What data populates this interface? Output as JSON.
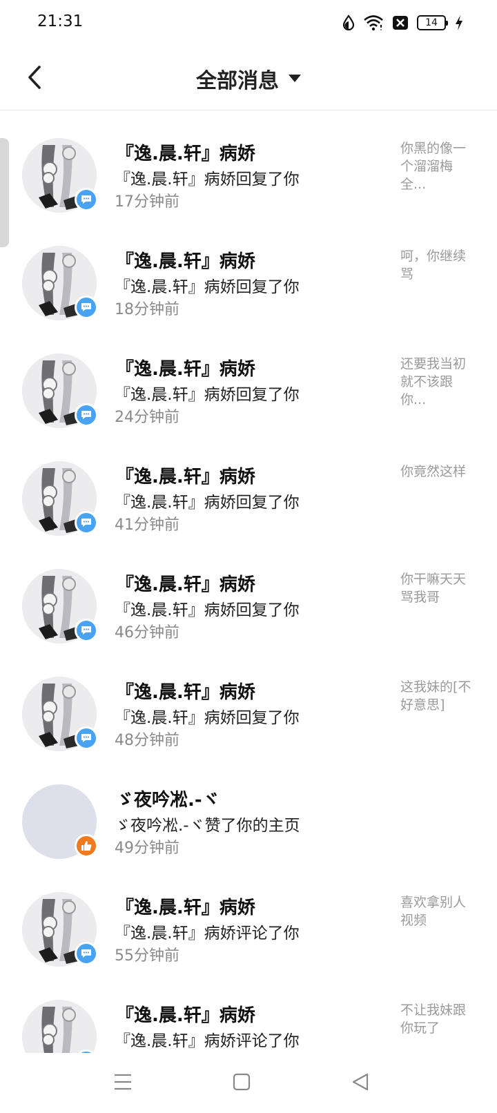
{
  "status_bar": {
    "time": "21:31",
    "battery_level": "14",
    "icons": [
      "data-saver-icon",
      "wifi-icon",
      "sim-blocked-icon",
      "battery-icon",
      "charging-icon"
    ]
  },
  "header": {
    "title": "全部消息",
    "back_icon": "chevron-left-icon",
    "dropdown_icon": "caret-down-icon"
  },
  "messages": [
    {
      "name": "『逸.晨.轩』病娇",
      "action": "『逸.晨.轩』病娇回复了你",
      "time": "17分钟前",
      "preview": "你黑的像一个溜溜梅全...",
      "badge": "comment"
    },
    {
      "name": "『逸.晨.轩』病娇",
      "action": "『逸.晨.轩』病娇回复了你",
      "time": "18分钟前",
      "preview": "呵，你继续骂",
      "badge": "comment"
    },
    {
      "name": "『逸.晨.轩』病娇",
      "action": "『逸.晨.轩』病娇回复了你",
      "time": "24分钟前",
      "preview": "还要我当初就不该跟你...",
      "badge": "comment"
    },
    {
      "name": "『逸.晨.轩』病娇",
      "action": "『逸.晨.轩』病娇回复了你",
      "time": "41分钟前",
      "preview": "你竟然这样",
      "badge": "comment"
    },
    {
      "name": "『逸.晨.轩』病娇",
      "action": "『逸.晨.轩』病娇回复了你",
      "time": "46分钟前",
      "preview": "你干嘛天天骂我哥",
      "badge": "comment"
    },
    {
      "name": "『逸.晨.轩』病娇",
      "action": "『逸.晨.轩』病娇回复了你",
      "time": "48分钟前",
      "preview": "这我妹的[不好意思]",
      "badge": "comment"
    },
    {
      "name": "ゞ夜吟凇.-ヾ",
      "action": "ゞ夜吟凇.-ヾ赞了你的主页",
      "time": "49分钟前",
      "preview": "",
      "badge": "like"
    },
    {
      "name": "『逸.晨.轩』病娇",
      "action": "『逸.晨.轩』病娇评论了你",
      "time": "55分钟前",
      "preview": "喜欢拿别人视频",
      "badge": "comment"
    },
    {
      "name": "『逸.晨.轩』病娇",
      "action": "『逸.晨.轩』病娇评论了你",
      "time": "",
      "preview": "不让我妹跟你玩了",
      "badge": "comment"
    }
  ],
  "nav_bar": {
    "icons": [
      "menu-icon",
      "home-square-icon",
      "back-triangle-icon"
    ]
  },
  "colors": {
    "comment_badge": "#4aa3f0",
    "like_badge": "#f07a1e",
    "secondary_text": "#8a8a8a"
  }
}
